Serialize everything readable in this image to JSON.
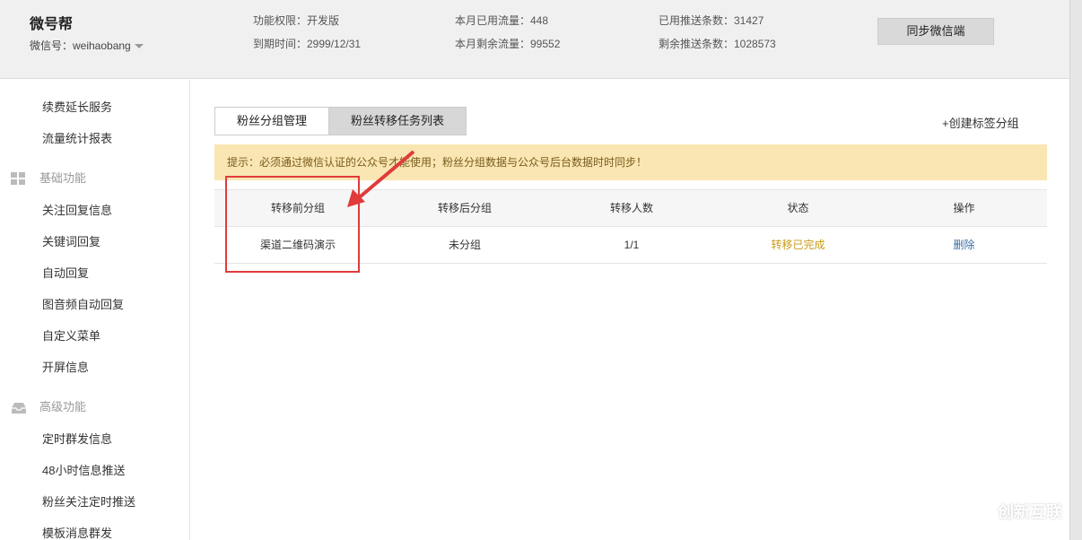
{
  "account": {
    "name": "微号帮",
    "id_label": "微信号：weihaobang"
  },
  "stats": {
    "permission": "功能权限：开发版",
    "expire": "到期时间：2999/12/31",
    "used_flow": "本月已用流量：448",
    "remain_flow": "本月剩余流量：99552",
    "used_push": "已用推送条数：31427",
    "remain_push": "剩余推送条数：1028573"
  },
  "sync_button": "同步微信端",
  "sidebar": {
    "items_top": [
      "续费延长服务",
      "流量统计报表"
    ],
    "group_basic": "基础功能",
    "items_basic": [
      "关注回复信息",
      "关键词回复",
      "自动回复",
      "图音频自动回复",
      "自定义菜单",
      "开屏信息"
    ],
    "group_advanced": "高级功能",
    "items_advanced": [
      "定时群发信息",
      "48小时信息推送",
      "粉丝关注定时推送",
      "模板消息群发"
    ]
  },
  "tabs": [
    "粉丝分组管理",
    "粉丝转移任务列表"
  ],
  "create_link": "+创建标签分组",
  "notice": "提示：必须通过微信认证的公众号才能使用；粉丝分组数据与公众号后台数据时时同步！",
  "table": {
    "headers": [
      "转移前分组",
      "转移后分组",
      "转移人数",
      "状态",
      "操作"
    ],
    "rows": [
      {
        "from": "渠道二维码演示",
        "to": "未分组",
        "count": "1/1",
        "status": "转移已完成",
        "action": "删除"
      }
    ]
  },
  "watermark": "创新互联",
  "colors": {
    "highlight": "#e03b3b",
    "status": "#c99a1a",
    "link": "#3a6ea5",
    "notice_bg": "#f9e6b2"
  }
}
